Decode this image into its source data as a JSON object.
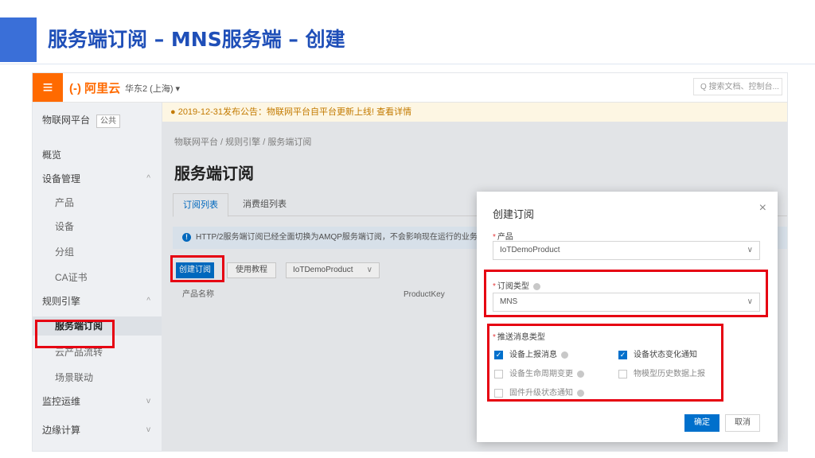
{
  "slide": {
    "title": "服务端订阅 – MNS服务端 – 创建"
  },
  "topbar": {
    "menu_glyph": "≡",
    "brand": "(-) 阿里云",
    "region": "华东2 (上海) ▾",
    "search_placeholder": "Q 搜索文档、控制台..."
  },
  "notice": "● 2019-12-31发布公告：物联网平台自平台更新上线! 查看详情",
  "sidebar": {
    "header": "物联网平台",
    "header_tag": "公共",
    "items": [
      {
        "label": "概览"
      },
      {
        "label": "设备管理",
        "chev": "^"
      },
      {
        "label": "产品"
      },
      {
        "label": "设备"
      },
      {
        "label": "分组"
      },
      {
        "label": "CA证书"
      },
      {
        "label": "规则引擎",
        "chev": "^"
      },
      {
        "label": "服务端订阅"
      },
      {
        "label": "云产品流转"
      },
      {
        "label": "场景联动"
      },
      {
        "label": "监控运维",
        "chev": "v"
      },
      {
        "label": "边缘计算",
        "chev": "v"
      }
    ]
  },
  "breadcrumb": "物联网平台 / 规则引擎 / 服务端订阅",
  "page_title": "服务端订阅",
  "tabs": [
    "订阅列表",
    "消费组列表"
  ],
  "info": {
    "dot": "!",
    "text": "HTTP/2服务端订阅已经全面切换为AMQP服务端订阅，不会影响现在运行的业务。"
  },
  "toolbar": {
    "create_label": "创建订阅",
    "docs_label": "使用教程",
    "product_select": "IoTDemoProduct"
  },
  "table": {
    "col_product": "产品名称",
    "col_key": "ProductKey"
  },
  "modal": {
    "title": "创建订阅",
    "close": "×",
    "product_label": "产品",
    "product_value": "IoTDemoProduct",
    "type_label": "订阅类型",
    "type_value": "MNS",
    "msg_label": "推送消息类型",
    "options": [
      {
        "label": "设备上报消息",
        "checked": true,
        "disabled": false
      },
      {
        "label": "设备状态变化通知",
        "checked": true,
        "disabled": false
      },
      {
        "label": "设备生命周期变更",
        "checked": false,
        "disabled": true
      },
      {
        "label": "物模型历史数据上报",
        "checked": false,
        "disabled": true
      },
      {
        "label": "固件升级状态通知",
        "checked": false,
        "disabled": true
      }
    ],
    "ok_label": "确定",
    "cancel_label": "取消"
  },
  "colors": {
    "brand_orange": "#ff6a00",
    "primary_blue": "#0070cc",
    "highlight_red": "#e60012",
    "slide_blue": "#1f4fb8"
  },
  "icons": [
    "menu-icon",
    "search-icon",
    "chevron-down-icon",
    "info-icon",
    "close-icon",
    "help-icon",
    "check-icon"
  ]
}
